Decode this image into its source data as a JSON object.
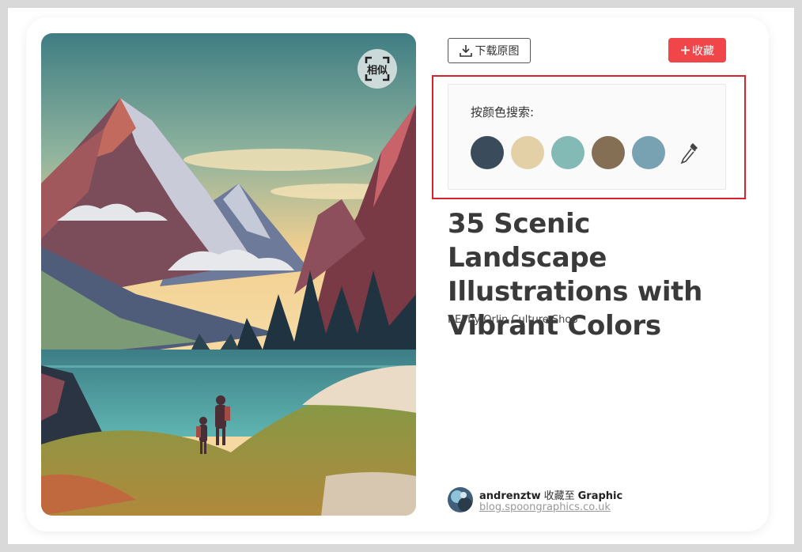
{
  "actions": {
    "similar_label": "相似",
    "download_label": "下载原图",
    "collect_label": "收藏"
  },
  "color_search": {
    "label": "按颜色搜索:",
    "swatches": [
      {
        "name": "dark-slate",
        "color": "#3a4b5c"
      },
      {
        "name": "sand",
        "color": "#e3d0a6"
      },
      {
        "name": "teal",
        "color": "#84bab6"
      },
      {
        "name": "brown",
        "color": "#846f55"
      },
      {
        "name": "steel-blue",
        "color": "#78a2b2"
      }
    ],
    "picker_icon": "eyedropper-icon"
  },
  "pin": {
    "title": "35 Scenic Landscape Illustrations with Vibrant Colors",
    "subtitle": "REI by Orlin Culture Shop"
  },
  "credit": {
    "user": "andrenztw",
    "action": "收藏至",
    "board": "Graphic",
    "source": "blog.spoongraphics.co.uk"
  },
  "colors": {
    "accent": "#f0464a",
    "highlight_border": "#d9212b"
  }
}
